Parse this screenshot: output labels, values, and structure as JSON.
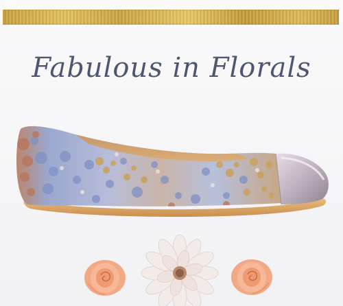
{
  "headline": "Fabulous in Florals",
  "colors": {
    "gold_bar": "#d4b04e",
    "headline_text": "#4d5770",
    "background": "#f7f6f7",
    "shoe_sole": "#d9a868",
    "shoe_toe_cap": "#c9bcc8",
    "floral_blue": "#8a9cc8",
    "floral_gold": "#c9a15a",
    "rose_peach": "#f0a37c"
  },
  "illustration": {
    "subject": "ballet-flat-shoe",
    "decor": [
      "peach-rose-icon",
      "white-dahlia-icon",
      "peach-rose-icon"
    ]
  }
}
